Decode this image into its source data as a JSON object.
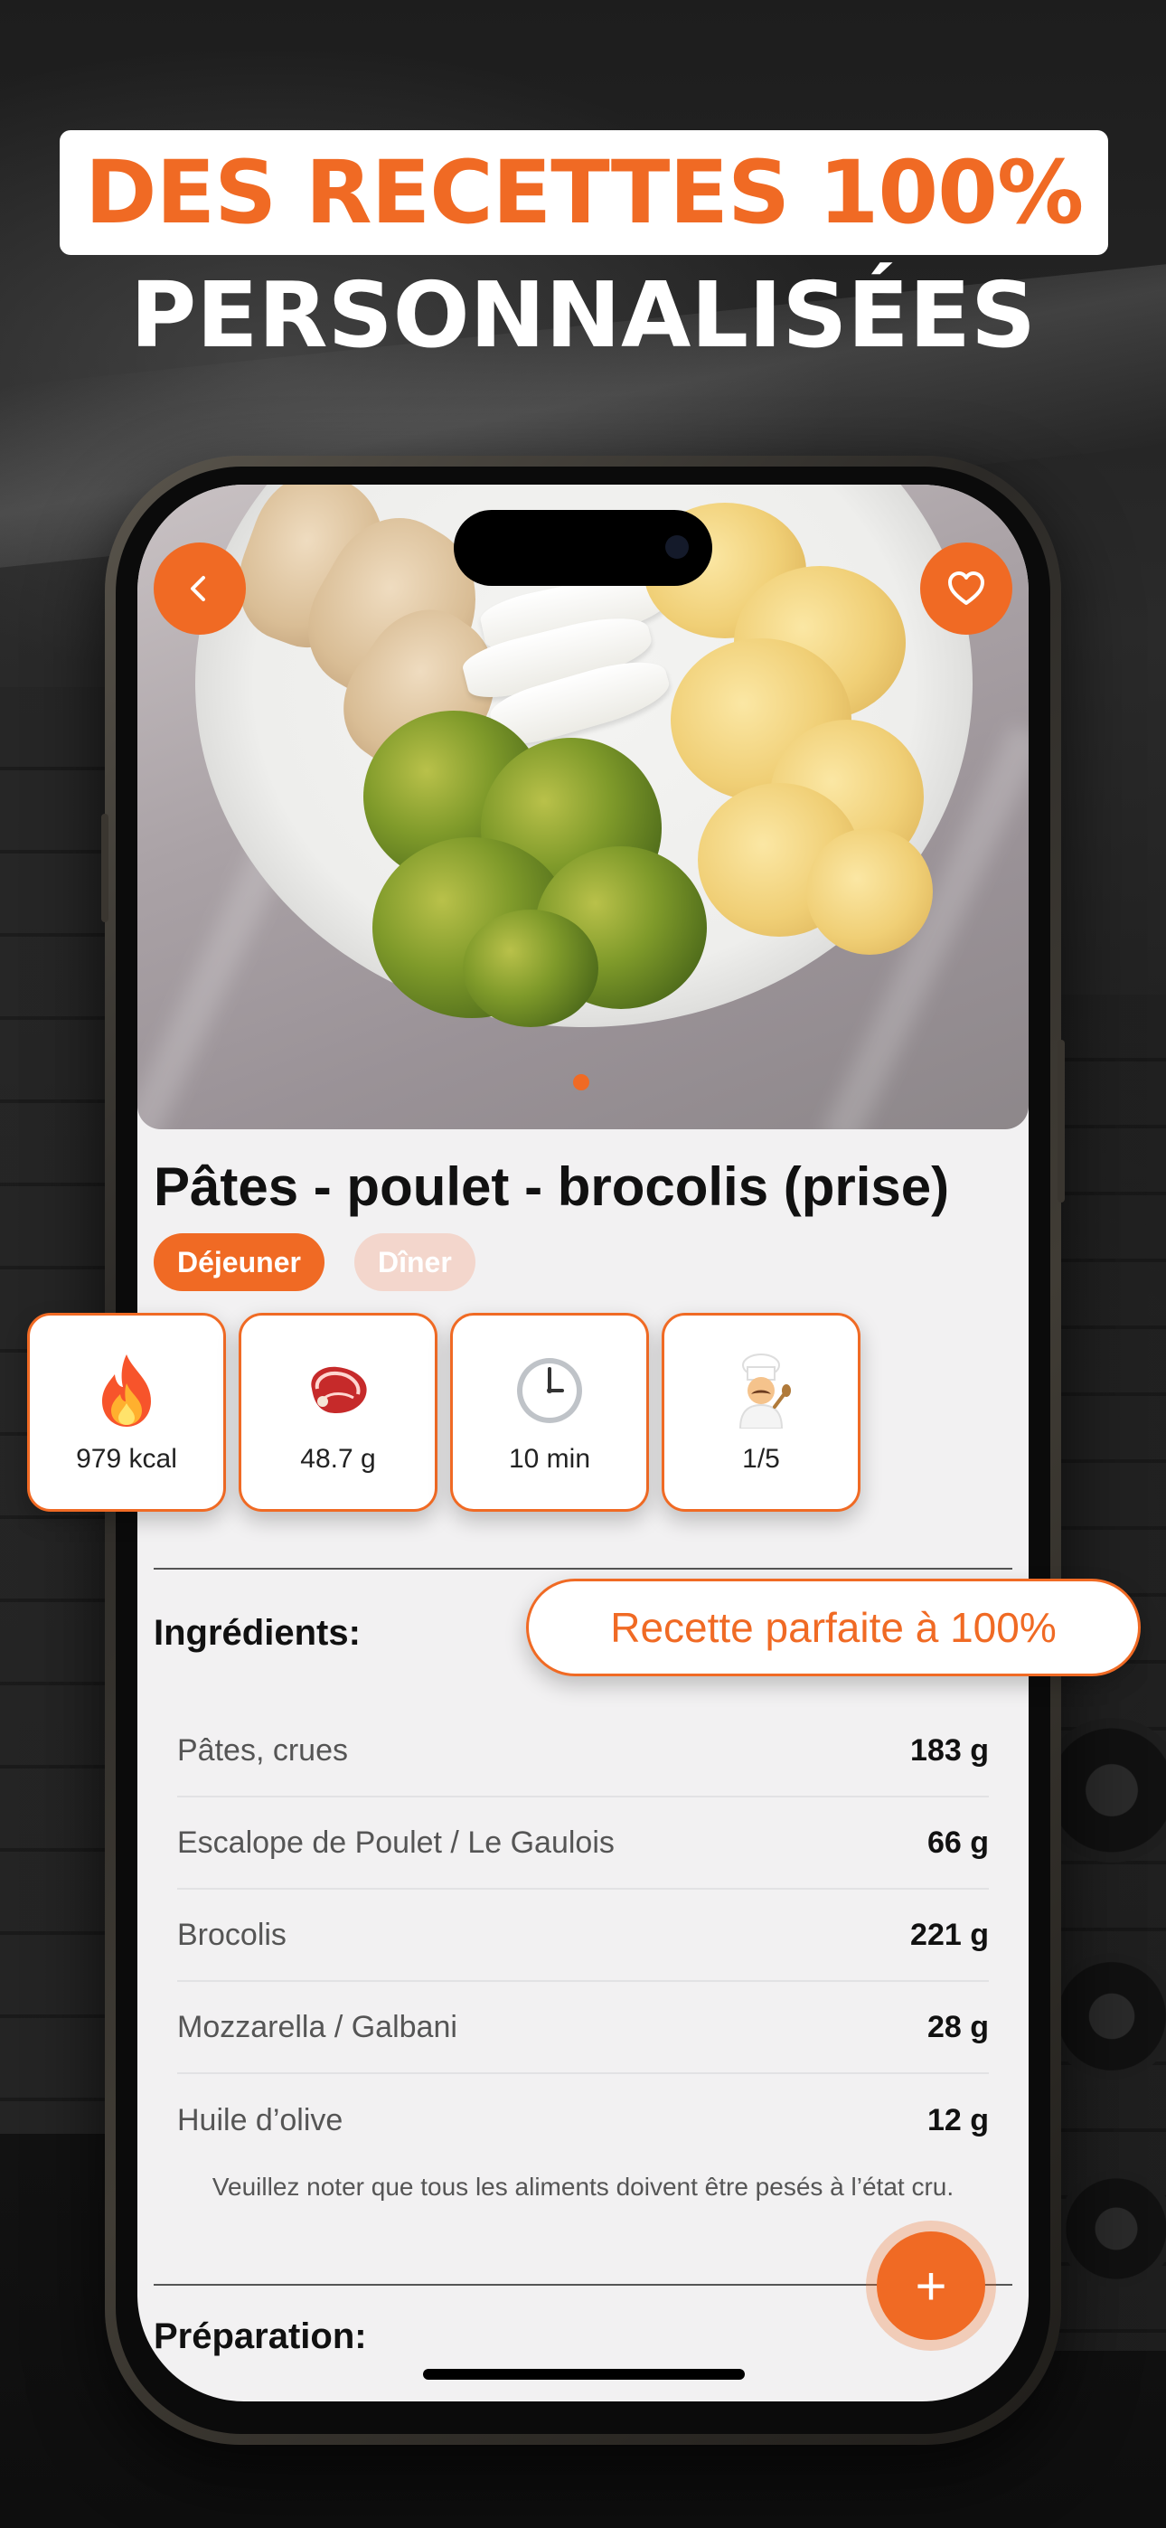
{
  "headline": {
    "line1": "DES RECETTES 100%",
    "line2": "PERSONNALISÉES"
  },
  "colors": {
    "accent": "#f06a24",
    "background": "#141414",
    "screen": "#f2f1f2"
  },
  "nav": {
    "back_icon": "chevron-left-icon",
    "favorite_icon": "heart-icon"
  },
  "carousel": {
    "current_page": 1,
    "total_pages": 1
  },
  "recipe": {
    "title": "Pâtes - poulet - brocolis (prise)",
    "tags": [
      "Déjeuner",
      "Dîner"
    ],
    "active_tag": "Déjeuner"
  },
  "stats": [
    {
      "icon": "fire-icon",
      "value": "979 kcal"
    },
    {
      "icon": "meat-icon",
      "value": "48.7 g"
    },
    {
      "icon": "clock-icon",
      "value": "10 min"
    },
    {
      "icon": "chef-icon",
      "value": "1/5"
    }
  ],
  "badge": {
    "label": "Recette parfaite à 100%"
  },
  "ingredients": {
    "title": "Ingrédients:",
    "items": [
      {
        "name": "Pâtes, crues",
        "qty": "183 g"
      },
      {
        "name": "Escalope de Poulet / Le Gaulois",
        "qty": "66 g"
      },
      {
        "name": "Brocolis",
        "qty": "221 g"
      },
      {
        "name": "Mozzarella / Galbani",
        "qty": "28 g"
      },
      {
        "name": "Huile d’olive",
        "qty": "12 g"
      }
    ],
    "note": "Veuillez noter que tous les aliments doivent être pesés à l’état cru."
  },
  "preparation": {
    "title": "Préparation:"
  },
  "fab": {
    "label": "+"
  }
}
